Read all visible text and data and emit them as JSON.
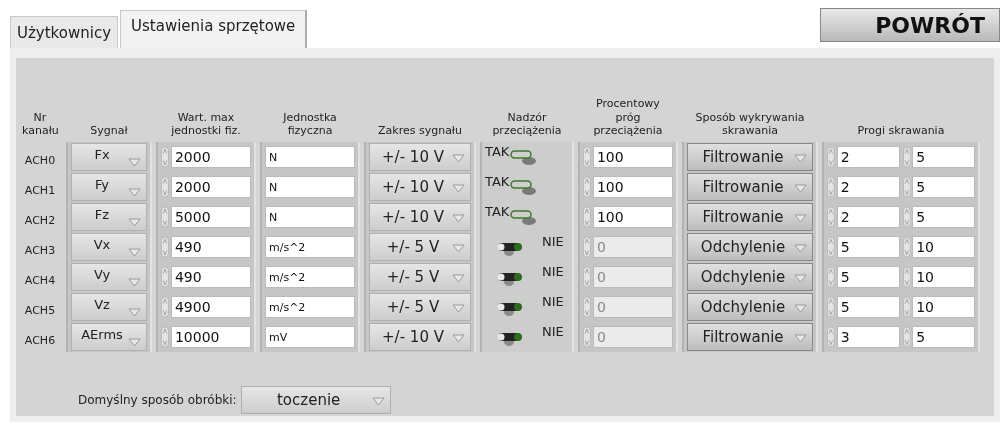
{
  "tabs": [
    {
      "label": "Użytkownicy",
      "selected": false
    },
    {
      "label": "Ustawienia sprzętowe",
      "selected": true
    }
  ],
  "return_button": "POWRÓT",
  "columns": [
    "Nr kanału",
    "Sygnał",
    "Wart. max jednostki fiz.",
    "Jednostka fizyczna",
    "Zakres sygnału",
    "Nadzór przeciążenia",
    "Procentowy próg przeciążenia",
    "Sposób wykrywania skrawania",
    "Progi skrawania"
  ],
  "rows": [
    {
      "channel": "ACH0",
      "signal": "Fx",
      "max_value": "2000",
      "unit": "N",
      "range": "+/- 10 V",
      "overload": {
        "on": true,
        "label": "TAK"
      },
      "percent": {
        "value": "100",
        "disabled": false
      },
      "detection": "Filtrowanie",
      "threshold_low": "2",
      "threshold_high": "5"
    },
    {
      "channel": "ACH1",
      "signal": "Fy",
      "max_value": "2000",
      "unit": "N",
      "range": "+/- 10 V",
      "overload": {
        "on": true,
        "label": "TAK"
      },
      "percent": {
        "value": "100",
        "disabled": false
      },
      "detection": "Filtrowanie",
      "threshold_low": "2",
      "threshold_high": "5"
    },
    {
      "channel": "ACH2",
      "signal": "Fz",
      "max_value": "5000",
      "unit": "N",
      "range": "+/- 10 V",
      "overload": {
        "on": true,
        "label": "TAK"
      },
      "percent": {
        "value": "100",
        "disabled": false
      },
      "detection": "Filtrowanie",
      "threshold_low": "2",
      "threshold_high": "5"
    },
    {
      "channel": "ACH3",
      "signal": "Vx",
      "max_value": "490",
      "unit": "m/s^2",
      "range": "+/- 5 V",
      "overload": {
        "on": false,
        "label": "NIE"
      },
      "percent": {
        "value": "0",
        "disabled": true
      },
      "detection": "Odchylenie",
      "threshold_low": "5",
      "threshold_high": "10"
    },
    {
      "channel": "ACH4",
      "signal": "Vy",
      "max_value": "490",
      "unit": "m/s^2",
      "range": "+/- 5 V",
      "overload": {
        "on": false,
        "label": "NIE"
      },
      "percent": {
        "value": "0",
        "disabled": true
      },
      "detection": "Odchylenie",
      "threshold_low": "5",
      "threshold_high": "10"
    },
    {
      "channel": "ACH5",
      "signal": "Vz",
      "max_value": "4900",
      "unit": "m/s^2",
      "range": "+/- 5 V",
      "overload": {
        "on": false,
        "label": "NIE"
      },
      "percent": {
        "value": "0",
        "disabled": true
      },
      "detection": "Odchylenie",
      "threshold_low": "5",
      "threshold_high": "10"
    },
    {
      "channel": "ACH6",
      "signal": "AErms",
      "max_value": "10000",
      "unit": "mV",
      "range": "+/- 10 V",
      "overload": {
        "on": false,
        "label": "NIE"
      },
      "percent": {
        "value": "0",
        "disabled": true
      },
      "detection": "Filtrowanie",
      "threshold_low": "3",
      "threshold_high": "5"
    }
  ],
  "default_machining": {
    "label": "Domyślny sposób obróbki:",
    "value": "toczenie"
  }
}
